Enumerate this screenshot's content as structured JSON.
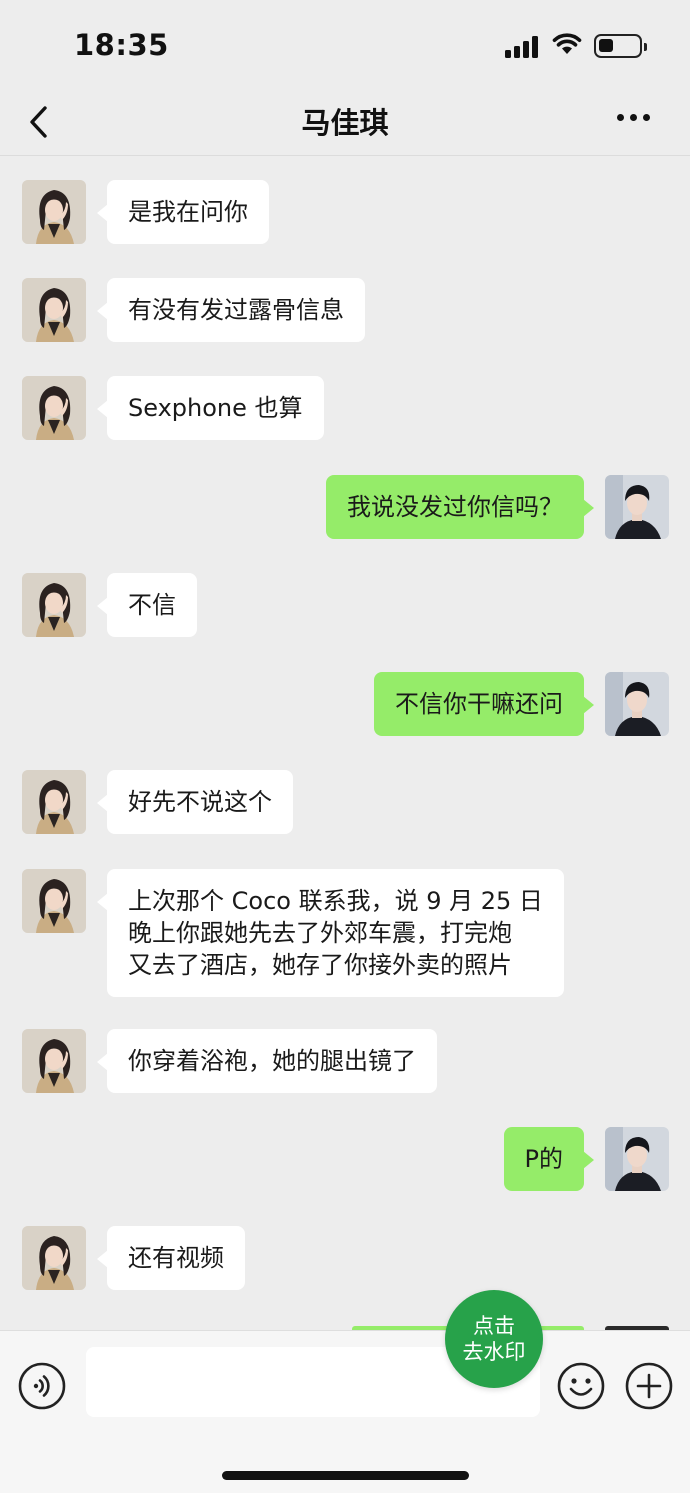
{
  "status_bar": {
    "time": "18:35"
  },
  "nav": {
    "title": "马佳琪"
  },
  "messages": [
    {
      "dir": "in",
      "text": "是我在问你"
    },
    {
      "dir": "in",
      "text": "有没有发过露骨信息"
    },
    {
      "dir": "in",
      "text": "Sexphone 也算"
    },
    {
      "dir": "out",
      "text": "我说没发过你信吗？"
    },
    {
      "dir": "in",
      "text": "不信"
    },
    {
      "dir": "out",
      "text": "不信你干嘛还问"
    },
    {
      "dir": "in",
      "text": "好先不说这个"
    },
    {
      "dir": "in",
      "text": "上次那个 Coco 联系我，说 9 月 25 日\n晚上你跟她先去了外郊车震，打完炮\n又去了酒店，她存了你接外卖的照片"
    },
    {
      "dir": "in",
      "text": "你穿着浴袍，她的腿出镜了"
    },
    {
      "dir": "out",
      "text": "P的"
    },
    {
      "dir": "in",
      "text": "还有视频"
    }
  ],
  "watermark_button": {
    "line1": "点击",
    "line2": "去水印"
  },
  "icons": {
    "back": "back-chevron-icon",
    "more": "more-dots-icon",
    "voice": "voice-icon",
    "emoji": "emoji-icon",
    "plus": "plus-icon",
    "signal": "signal-icon",
    "wifi": "wifi-icon",
    "battery": "battery-icon"
  },
  "colors": {
    "background": "#ededed",
    "incoming_bubble": "#ffffff",
    "outgoing_bubble": "#95ec69",
    "watermark_button": "#27a24a"
  }
}
